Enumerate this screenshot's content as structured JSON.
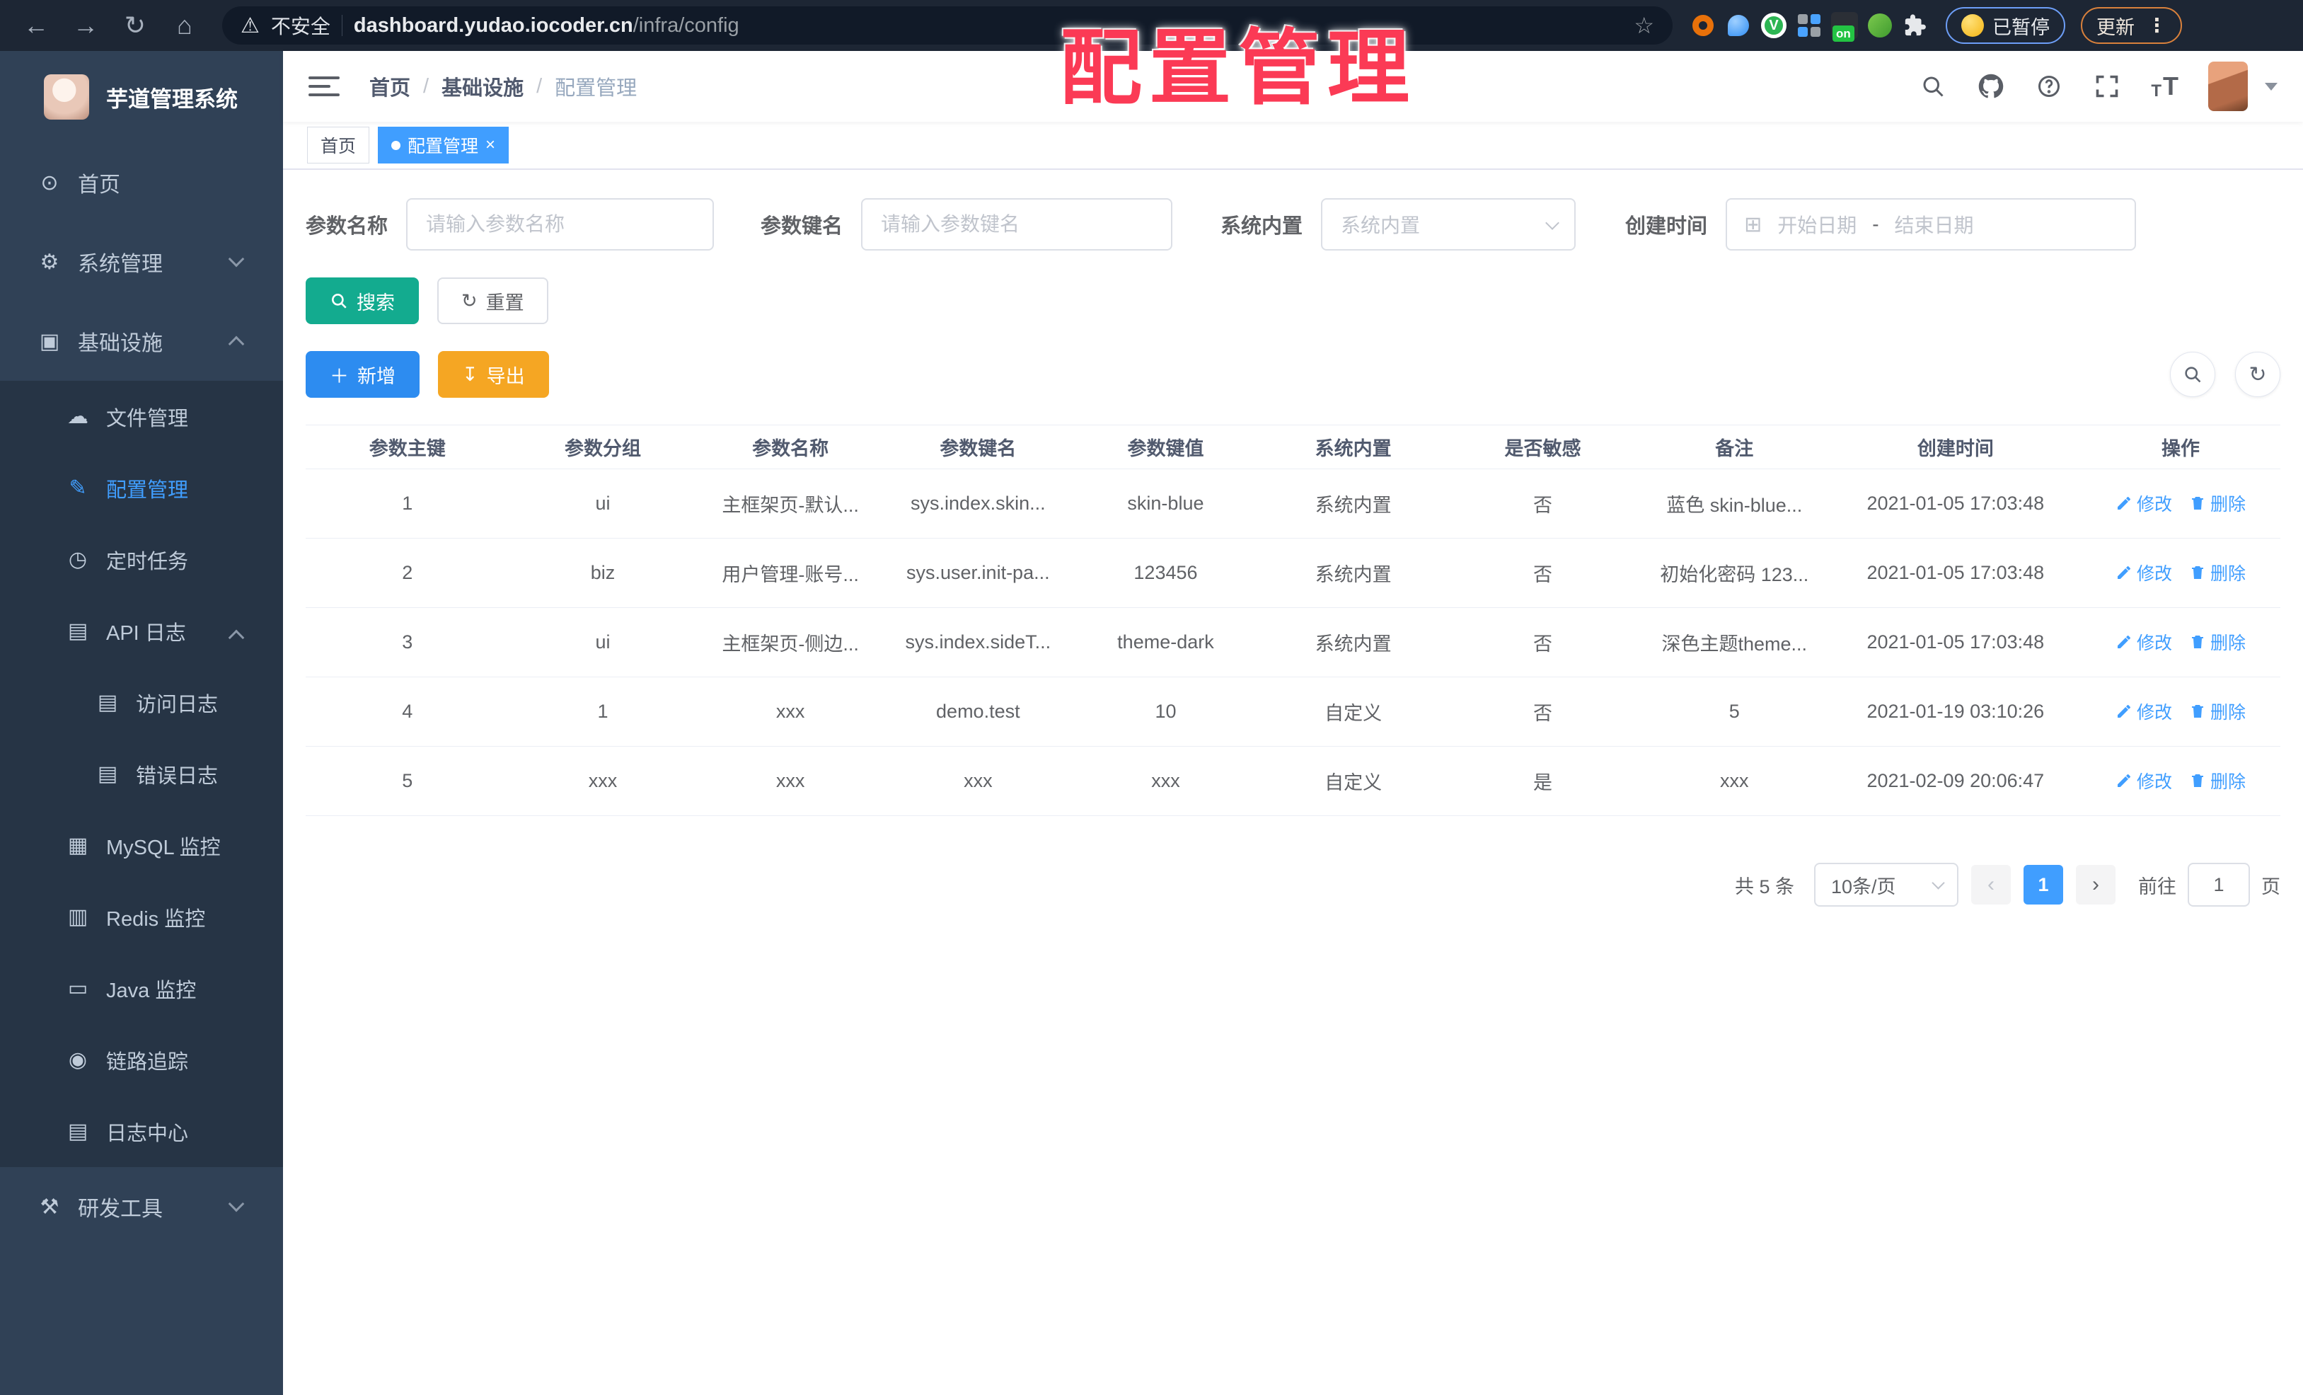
{
  "browser": {
    "security_label": "不安全",
    "url_host": "dashboard.yudao.iocoder.cn",
    "url_path": "/infra/config",
    "paused_badge": "已暂停",
    "update_label": "更新"
  },
  "overlay_title": "配置管理",
  "sidebar": {
    "logo_title": "芋道管理系统",
    "items": [
      {
        "name": "home",
        "label": "首页",
        "icon": "dashboard",
        "glyph": "⊙",
        "level": 1,
        "sub": false,
        "active": false,
        "arrow": null
      },
      {
        "name": "system-management",
        "label": "系统管理",
        "icon": "gear",
        "glyph": "⚙",
        "level": 1,
        "sub": false,
        "active": false,
        "arrow": "down"
      },
      {
        "name": "infrastructure",
        "label": "基础设施",
        "icon": "monitor",
        "glyph": "▣",
        "level": 1,
        "sub": false,
        "active": false,
        "arrow": "up"
      },
      {
        "name": "file-management",
        "label": "文件管理",
        "icon": "cloud",
        "glyph": "☁",
        "level": 2,
        "sub": true,
        "active": false,
        "arrow": null
      },
      {
        "name": "config-management",
        "label": "配置管理",
        "icon": "edit",
        "glyph": "✎",
        "level": 2,
        "sub": true,
        "active": true,
        "arrow": null
      },
      {
        "name": "scheduled-jobs",
        "label": "定时任务",
        "icon": "clock",
        "glyph": "◷",
        "level": 2,
        "sub": true,
        "active": false,
        "arrow": null
      },
      {
        "name": "api-logs",
        "label": "API 日志",
        "icon": "log",
        "glyph": "▤",
        "level": 2,
        "sub": true,
        "active": false,
        "arrow": "up"
      },
      {
        "name": "access-logs",
        "label": "访问日志",
        "icon": "log",
        "glyph": "▤",
        "level": 3,
        "sub": true,
        "active": false,
        "arrow": null
      },
      {
        "name": "error-logs",
        "label": "错误日志",
        "icon": "log",
        "glyph": "▤",
        "level": 3,
        "sub": true,
        "active": false,
        "arrow": null
      },
      {
        "name": "mysql-monitor",
        "label": "MySQL 监控",
        "icon": "database",
        "glyph": "▦",
        "level": 2,
        "sub": true,
        "active": false,
        "arrow": null
      },
      {
        "name": "redis-monitor",
        "label": "Redis 监控",
        "icon": "stack",
        "glyph": "▥",
        "level": 2,
        "sub": true,
        "active": false,
        "arrow": null
      },
      {
        "name": "java-monitor",
        "label": "Java 监控",
        "icon": "screen",
        "glyph": "▭",
        "level": 2,
        "sub": true,
        "active": false,
        "arrow": null
      },
      {
        "name": "trace",
        "label": "链路追踪",
        "icon": "eye",
        "glyph": "◉",
        "level": 2,
        "sub": true,
        "active": false,
        "arrow": null
      },
      {
        "name": "log-center",
        "label": "日志中心",
        "icon": "log",
        "glyph": "▤",
        "level": 2,
        "sub": true,
        "active": false,
        "arrow": null
      },
      {
        "name": "dev-tools",
        "label": "研发工具",
        "icon": "toolbox",
        "glyph": "⚒",
        "level": 1,
        "sub": false,
        "active": false,
        "arrow": "down"
      }
    ]
  },
  "header": {
    "breadcrumb": [
      "首页",
      "基础设施",
      "配置管理"
    ]
  },
  "tabs": {
    "home": "首页",
    "current": "配置管理"
  },
  "filters": {
    "param_name_label": "参数名称",
    "param_name_placeholder": "请输入参数名称",
    "param_key_label": "参数键名",
    "param_key_placeholder": "请输入参数键名",
    "builtin_label": "系统内置",
    "builtin_placeholder": "系统内置",
    "create_time_label": "创建时间",
    "date_start_placeholder": "开始日期",
    "date_separator": "-",
    "date_end_placeholder": "结束日期"
  },
  "buttons": {
    "search": "搜索",
    "reset": "重置",
    "add": "新增",
    "export": "导出"
  },
  "table": {
    "headers": [
      "参数主键",
      "参数分组",
      "参数名称",
      "参数键名",
      "参数键值",
      "系统内置",
      "是否敏感",
      "备注",
      "创建时间",
      "操作"
    ],
    "action_labels": {
      "edit": "修改",
      "delete": "删除"
    },
    "rows": [
      {
        "id": "1",
        "group": "ui",
        "name": "主框架页-默认...",
        "key": "sys.index.skin...",
        "value": "skin-blue",
        "type": "系统内置",
        "sensitive": "否",
        "remark": "蓝色 skin-blue...",
        "created": "2021-01-05 17:03:48"
      },
      {
        "id": "2",
        "group": "biz",
        "name": "用户管理-账号...",
        "key": "sys.user.init-pa...",
        "value": "123456",
        "type": "系统内置",
        "sensitive": "否",
        "remark": "初始化密码 123...",
        "created": "2021-01-05 17:03:48"
      },
      {
        "id": "3",
        "group": "ui",
        "name": "主框架页-侧边...",
        "key": "sys.index.sideT...",
        "value": "theme-dark",
        "type": "系统内置",
        "sensitive": "否",
        "remark": "深色主题theme...",
        "created": "2021-01-05 17:03:48"
      },
      {
        "id": "4",
        "group": "1",
        "name": "xxx",
        "key": "demo.test",
        "value": "10",
        "type": "自定义",
        "sensitive": "否",
        "remark": "5",
        "created": "2021-01-19 03:10:26"
      },
      {
        "id": "5",
        "group": "xxx",
        "name": "xxx",
        "key": "xxx",
        "value": "xxx",
        "type": "自定义",
        "sensitive": "是",
        "remark": "xxx",
        "created": "2021-02-09 20:06:47"
      }
    ]
  },
  "pagination": {
    "total": "共 5 条",
    "page_size": "10条/页",
    "prev": "‹",
    "current_page": "1",
    "next": "›",
    "goto_label": "前往",
    "goto_value": "1",
    "goto_unit": "页"
  },
  "colors": {
    "accent": "#409eff",
    "search_button": "#13ab8f",
    "add_button": "#2d8cf0",
    "export_button": "#f5a623",
    "overlay_title": "#fb3a55",
    "sidebar_bg": "#304156",
    "submenu_bg": "#263445"
  }
}
